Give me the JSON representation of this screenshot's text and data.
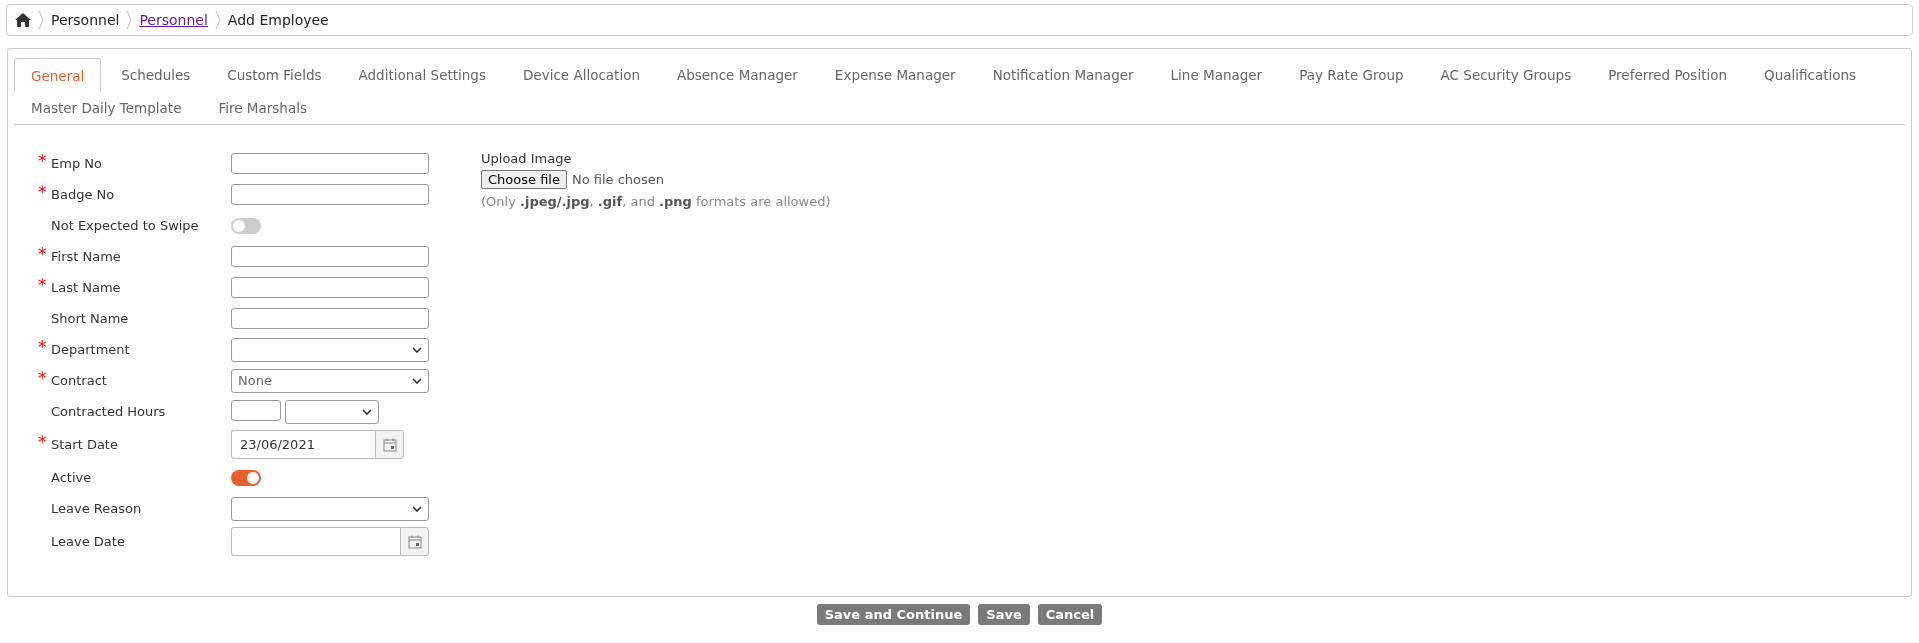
{
  "breadcrumb": [
    {
      "label": "Personnel",
      "link": false
    },
    {
      "label": "Personnel",
      "link": true
    },
    {
      "label": "Add Employee",
      "link": false
    }
  ],
  "tabs": [
    {
      "label": "General",
      "selected": true
    },
    {
      "label": "Schedules",
      "selected": false
    },
    {
      "label": "Custom Fields",
      "selected": false
    },
    {
      "label": "Additional Settings",
      "selected": false
    },
    {
      "label": "Device Allocation",
      "selected": false
    },
    {
      "label": "Absence Manager",
      "selected": false
    },
    {
      "label": "Expense Manager",
      "selected": false
    },
    {
      "label": "Notification Manager",
      "selected": false
    },
    {
      "label": "Line Manager",
      "selected": false
    },
    {
      "label": "Pay Rate Group",
      "selected": false
    },
    {
      "label": "AC Security Groups",
      "selected": false
    },
    {
      "label": "Preferred Position",
      "selected": false
    },
    {
      "label": "Qualifications",
      "selected": false
    },
    {
      "label": "Master Daily Template",
      "selected": false
    },
    {
      "label": "Fire Marshals",
      "selected": false
    }
  ],
  "fields": [
    {
      "label": "Emp No",
      "kind": "text",
      "required_mark": "*"
    },
    {
      "label": "Badge No",
      "kind": "text",
      "required_mark": "*"
    },
    {
      "label": "Not Expected to Swipe",
      "kind": "toggle",
      "on": false
    },
    {
      "label": "First Name",
      "kind": "text",
      "required_mark": "*"
    },
    {
      "label": "Last Name",
      "kind": "text",
      "required_mark": "*"
    },
    {
      "label": "Short Name",
      "kind": "text"
    },
    {
      "label": "Department",
      "kind": "select",
      "required_mark": "*"
    },
    {
      "label": "Contract",
      "kind": "select",
      "required_mark": "*",
      "value": "None"
    },
    {
      "label": "Contracted Hours",
      "kind": "hours"
    },
    {
      "label": "Start Date",
      "kind": "date",
      "required_mark": "*",
      "value": "23/06/2021"
    },
    {
      "label": "Active",
      "kind": "toggle",
      "on": true
    },
    {
      "label": "Leave Reason",
      "kind": "select"
    },
    {
      "label": "Leave Date",
      "kind": "date"
    }
  ],
  "upload": {
    "label": "Upload Image",
    "button": "Choose file",
    "status": "No file chosen",
    "note": "(Only **.jpeg/.jpg**, **.gif**, and **.png** formats are allowed)"
  },
  "buttons": [
    "Save and Continue",
    "Save",
    "Cancel"
  ]
}
